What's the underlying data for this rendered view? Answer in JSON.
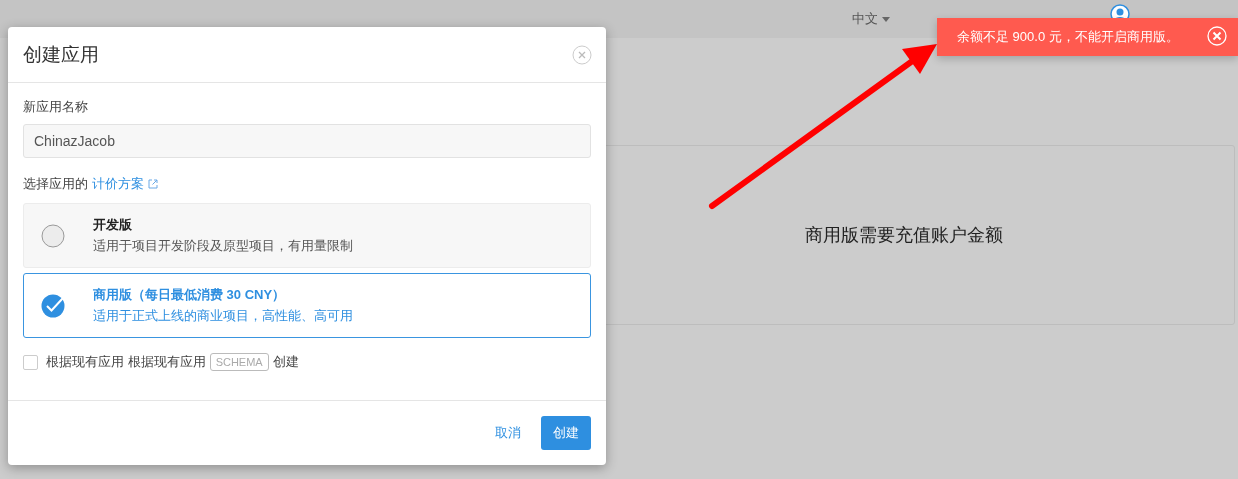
{
  "top_nav": {
    "language": "中文"
  },
  "panel": {
    "text": "商用版需要充值账户金额"
  },
  "toast": {
    "message": "余额不足 900.0 元，不能开启商用版。"
  },
  "modal": {
    "title": "创建应用",
    "name_label": "新应用名称",
    "name_value": "ChinazJacob",
    "plan_label": "选择应用的",
    "plan_link": "计价方案",
    "plans": [
      {
        "title": "开发版",
        "description": "适用于项目开发阶段及原型项目，有用量限制",
        "selected": false
      },
      {
        "title": "商用版（每日最低消费 30 CNY）",
        "description": "适用于正式上线的商业项目，高性能、高可用",
        "selected": true
      }
    ],
    "clone": {
      "checked": false,
      "label": "根据现有应用 根据现有应用",
      "tag": "SCHEMA",
      "suffix": "创建"
    },
    "cancel": "取消",
    "create": "创建"
  }
}
